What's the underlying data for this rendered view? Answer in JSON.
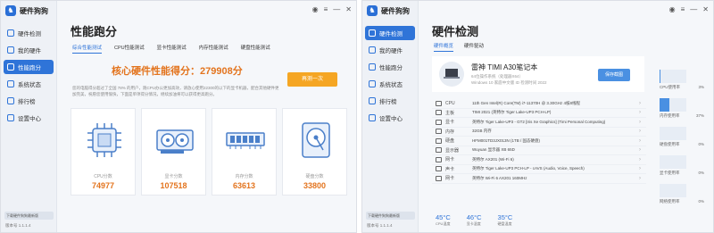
{
  "left": {
    "brand": "硬件狗狗",
    "nav": [
      {
        "label": "硬件检测"
      },
      {
        "label": "我的硬件"
      },
      {
        "label": "性能跑分"
      },
      {
        "label": "系统状态"
      },
      {
        "label": "排行榜"
      },
      {
        "label": "设置中心"
      }
    ],
    "side_bottom": "下载硬件狗狗最新版",
    "version": "版本号 1.1.1.4",
    "title": "性能跑分",
    "tabs": [
      "综合性能测试",
      "CPU性能测试",
      "显卡性能测试",
      "内存性能测试",
      "硬盘性能测试"
    ],
    "score_text": "核心硬件性能得分：279908分",
    "description": "您的电脑得分超过了全国 78% 的用户，跑CPU办公更加高效，请放心使用22300的以下的显卡机器，配合其他硬件更加完美，祝愿您使用愉快，下面是单项得分情况，继续加油将可以获得更高跑分。",
    "retest_label": "再测一次",
    "cards": [
      {
        "label": "CPU分数",
        "value": "74977",
        "icon": "cpu-chip-icon"
      },
      {
        "label": "显卡分数",
        "value": "107518",
        "icon": "graphics-card-icon"
      },
      {
        "label": "内存分数",
        "value": "63613",
        "icon": "memory-module-icon"
      },
      {
        "label": "硬盘分数",
        "value": "33800",
        "icon": "hard-disk-icon"
      }
    ]
  },
  "right": {
    "brand": "硬件狗狗",
    "nav": [
      {
        "label": "硬件检测"
      },
      {
        "label": "我的硬件"
      },
      {
        "label": "性能跑分"
      },
      {
        "label": "系统状态"
      },
      {
        "label": "排行榜"
      },
      {
        "label": "设置中心"
      }
    ],
    "version": "版本号 1.1.1.4",
    "title": "硬件检测",
    "tabs": [
      "硬件概览",
      "硬件驱动"
    ],
    "device": {
      "name": "雷神 TIMI A30笔记本",
      "sub1": "64位操作系统（处理器X64）",
      "sub2": "Windows 10 家庭中文版 ID 检测时间 2022"
    },
    "save_label": "保存截图",
    "specs": [
      {
        "label": "CPU",
        "value": "11th Gen Intel(R) Core(TM) i7-11370H @ 3.30GHz 4核8线程"
      },
      {
        "label": "主板",
        "value": "TIMI 2021 (英特尔 Tiger Lake-UP3 PCH-LP)"
      },
      {
        "label": "显卡",
        "value": "英特尔 Tiger Lake-UP3 - GT2 [Iris Xe Graphics] (Timi Personal Computing)"
      },
      {
        "label": "内存",
        "value": "32GB 内存"
      },
      {
        "label": "硬盘",
        "value": "HFM001TD3JX013N (1TB / 固态硬盘)"
      },
      {
        "label": "显示器",
        "value": "Wuyuan 显示器 XB 65D"
      },
      {
        "label": "网卡",
        "value": "英特尔 AX201 (Wi-Fi 6)"
      },
      {
        "label": "声卡",
        "value": "英特尔 Tiger Lake-UP3 PCH-LP - cAVS (Audio, Voice, Speech)"
      },
      {
        "label": "网卡",
        "value": "英特尔 Wi-Fi 6 AX201 160MHz"
      }
    ],
    "temps": [
      {
        "value": "45°C",
        "label": "CPU温度"
      },
      {
        "value": "46°C",
        "label": "显卡温度"
      },
      {
        "value": "35°C",
        "label": "硬盘温度"
      }
    ],
    "usage": [
      {
        "label": "CPU使用率",
        "value": "3%",
        "fraction": 0.03
      },
      {
        "label": "内存使用率",
        "value": "37%",
        "fraction": 0.37
      },
      {
        "label": "硬盘使用率",
        "value": "0%",
        "fraction": 0.0
      },
      {
        "label": "显卡使用率",
        "value": "0%",
        "fraction": 0.0
      },
      {
        "label": "网络使用率",
        "value": "0%",
        "fraction": 0.0
      }
    ]
  },
  "colors": {
    "accent": "#2f74d8",
    "score": "#e3741e",
    "button": "#f5a623"
  }
}
